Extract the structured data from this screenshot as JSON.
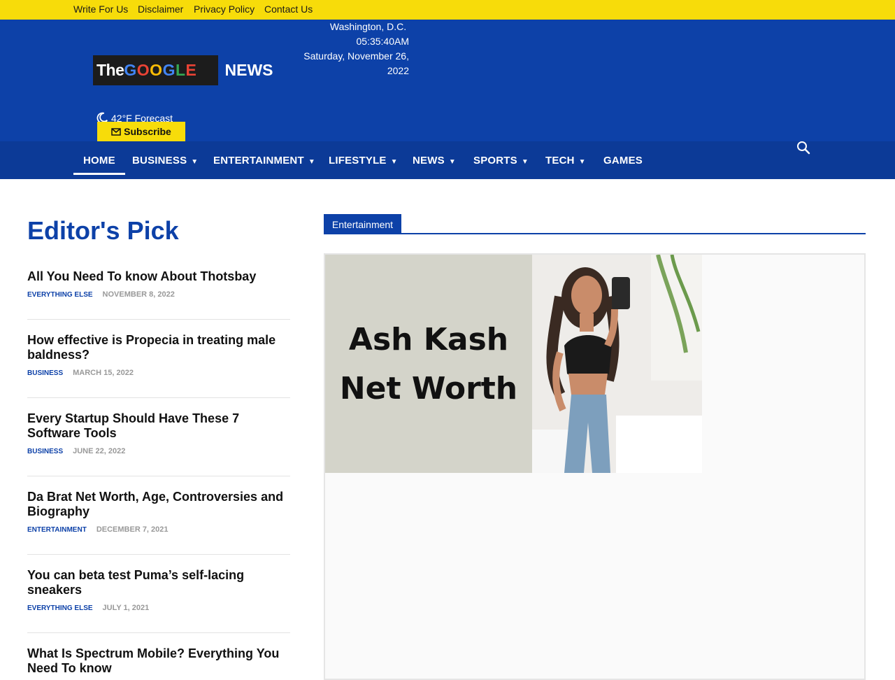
{
  "topbar": {
    "links": [
      "Write For Us",
      "Disclaimer",
      "Privacy Policy",
      "Contact Us"
    ]
  },
  "header": {
    "logo": {
      "the": "The",
      "google": "GOOGLE",
      "news": "NEWS"
    },
    "location": "Washington, D.C.",
    "time": "05:35:40AM",
    "date": "Saturday, November 26, 2022",
    "weather": "42°F Forecast",
    "subscribe_label": "Subscribe"
  },
  "nav": {
    "items": [
      {
        "label": "HOME",
        "dropdown": false,
        "active": true
      },
      {
        "label": "BUSINESS",
        "dropdown": true
      },
      {
        "label": "ENTERTAINMENT",
        "dropdown": true
      },
      {
        "label": "LIFESTYLE",
        "dropdown": true
      },
      {
        "label": "NEWS",
        "dropdown": true
      },
      {
        "label": "SPORTS",
        "dropdown": true
      },
      {
        "label": "TECH",
        "dropdown": true
      },
      {
        "label": "GAMES",
        "dropdown": false
      }
    ],
    "chevron": "⌄"
  },
  "editors_pick": {
    "title": "Editor's Pick",
    "articles": [
      {
        "title": "All You Need To know About Thotsbay",
        "category": "EVERYTHING ELSE",
        "date": "NOVEMBER 8, 2022"
      },
      {
        "title": "How effective is Propecia in treating male baldness?",
        "category": "BUSINESS",
        "date": "MARCH 15, 2022"
      },
      {
        "title": "Every Startup Should Have These 7 Software Tools",
        "category": "BUSINESS",
        "date": "JUNE 22, 2022"
      },
      {
        "title": "Da Brat Net Worth, Age, Controversies and Biography",
        "category": "ENTERTAINMENT",
        "date": "DECEMBER 7, 2021"
      },
      {
        "title": "You can beta test Puma’s self-lacing sneakers",
        "category": "EVERYTHING ELSE",
        "date": "JULY 1, 2021"
      },
      {
        "title": "What Is Spectrum Mobile? Everything You Need To know",
        "category": "",
        "date": ""
      }
    ]
  },
  "section": {
    "category_label": "Entertainment",
    "featured": {
      "image_line1": "Ash Kash",
      "image_line2": "Net Worth"
    }
  },
  "colors": {
    "brand_blue": "#0d41a8",
    "nav_blue": "#0c3a97",
    "accent_yellow": "#f7dc0a"
  }
}
